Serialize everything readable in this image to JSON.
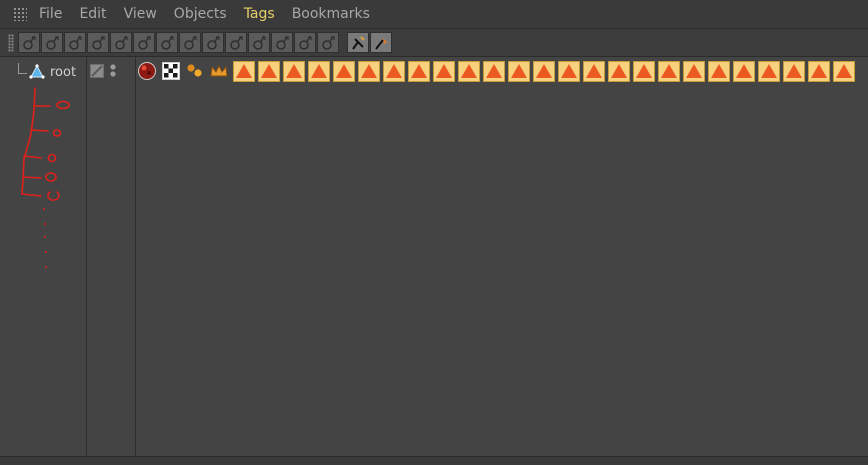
{
  "menubar": {
    "items": [
      {
        "label": "File",
        "active": false
      },
      {
        "label": "Edit",
        "active": false
      },
      {
        "label": "View",
        "active": false
      },
      {
        "label": "Objects",
        "active": false
      },
      {
        "label": "Tags",
        "active": true
      },
      {
        "label": "Bookmarks",
        "active": false
      }
    ]
  },
  "toolbar": {
    "button_icons": [
      "constraint-tag-icon",
      "constraint-tag-icon",
      "constraint-tag-icon",
      "constraint-tag-icon",
      "constraint-tag-icon",
      "constraint-tag-icon",
      "constraint-tag-icon",
      "constraint-tag-icon",
      "constraint-tag-icon",
      "constraint-tag-icon",
      "constraint-tag-icon",
      "constraint-tag-icon",
      "constraint-tag-icon",
      "constraint-tag-icon"
    ],
    "tool_icons": [
      "brush-tool-icon",
      "paint-tool-icon"
    ]
  },
  "tree": {
    "root_label": "root",
    "sketch_color": "#e0201a"
  },
  "tags": {
    "special_icons": [
      "red-ball-tag-icon",
      "checker-tag-icon",
      "dots-tag-icon",
      "crown-tag-icon"
    ],
    "ik_tag_count": 25,
    "ik_tag_icon": "triangle-tag-icon",
    "ik_tag_fill": "#f7d17d",
    "ik_tag_triangle": "#ec5a22"
  }
}
